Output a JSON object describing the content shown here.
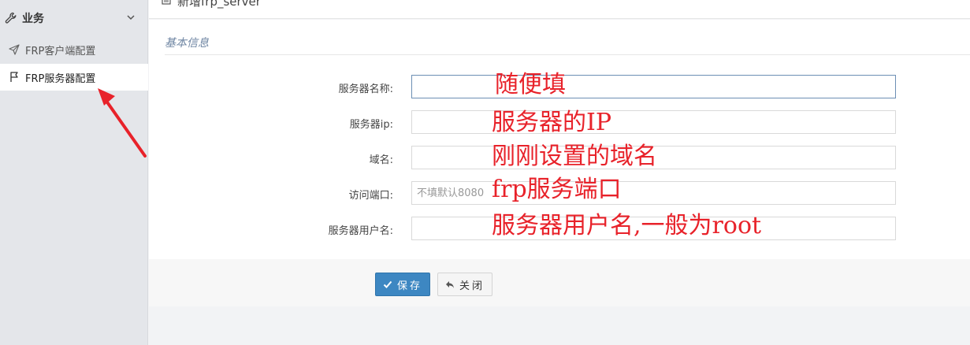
{
  "sidebar": {
    "group_title": "业务",
    "items": [
      {
        "label": "FRP客户端配置"
      },
      {
        "label": "FRP服务器配置"
      }
    ]
  },
  "topbar": {
    "title": "新增frp_server"
  },
  "form": {
    "section_title": "基本信息",
    "fields": [
      {
        "label": "服务器名称:",
        "value": "",
        "placeholder": ""
      },
      {
        "label": "服务器ip:",
        "value": "",
        "placeholder": ""
      },
      {
        "label": "域名:",
        "value": "",
        "placeholder": ""
      },
      {
        "label": "访问端口:",
        "value": "",
        "placeholder": "不填默认8080"
      },
      {
        "label": "服务器用户名:",
        "value": "",
        "placeholder": ""
      }
    ]
  },
  "annotations": [
    "随便填",
    "服务器的IP",
    "刚刚设置的域名",
    "frp服务端口",
    "服务器用户名,一般为root"
  ],
  "buttons": {
    "save": "保存",
    "close": "关闭"
  },
  "colors": {
    "primary": "#3d87c2",
    "annotation": "#e8222a",
    "section": "#6f86a3"
  }
}
